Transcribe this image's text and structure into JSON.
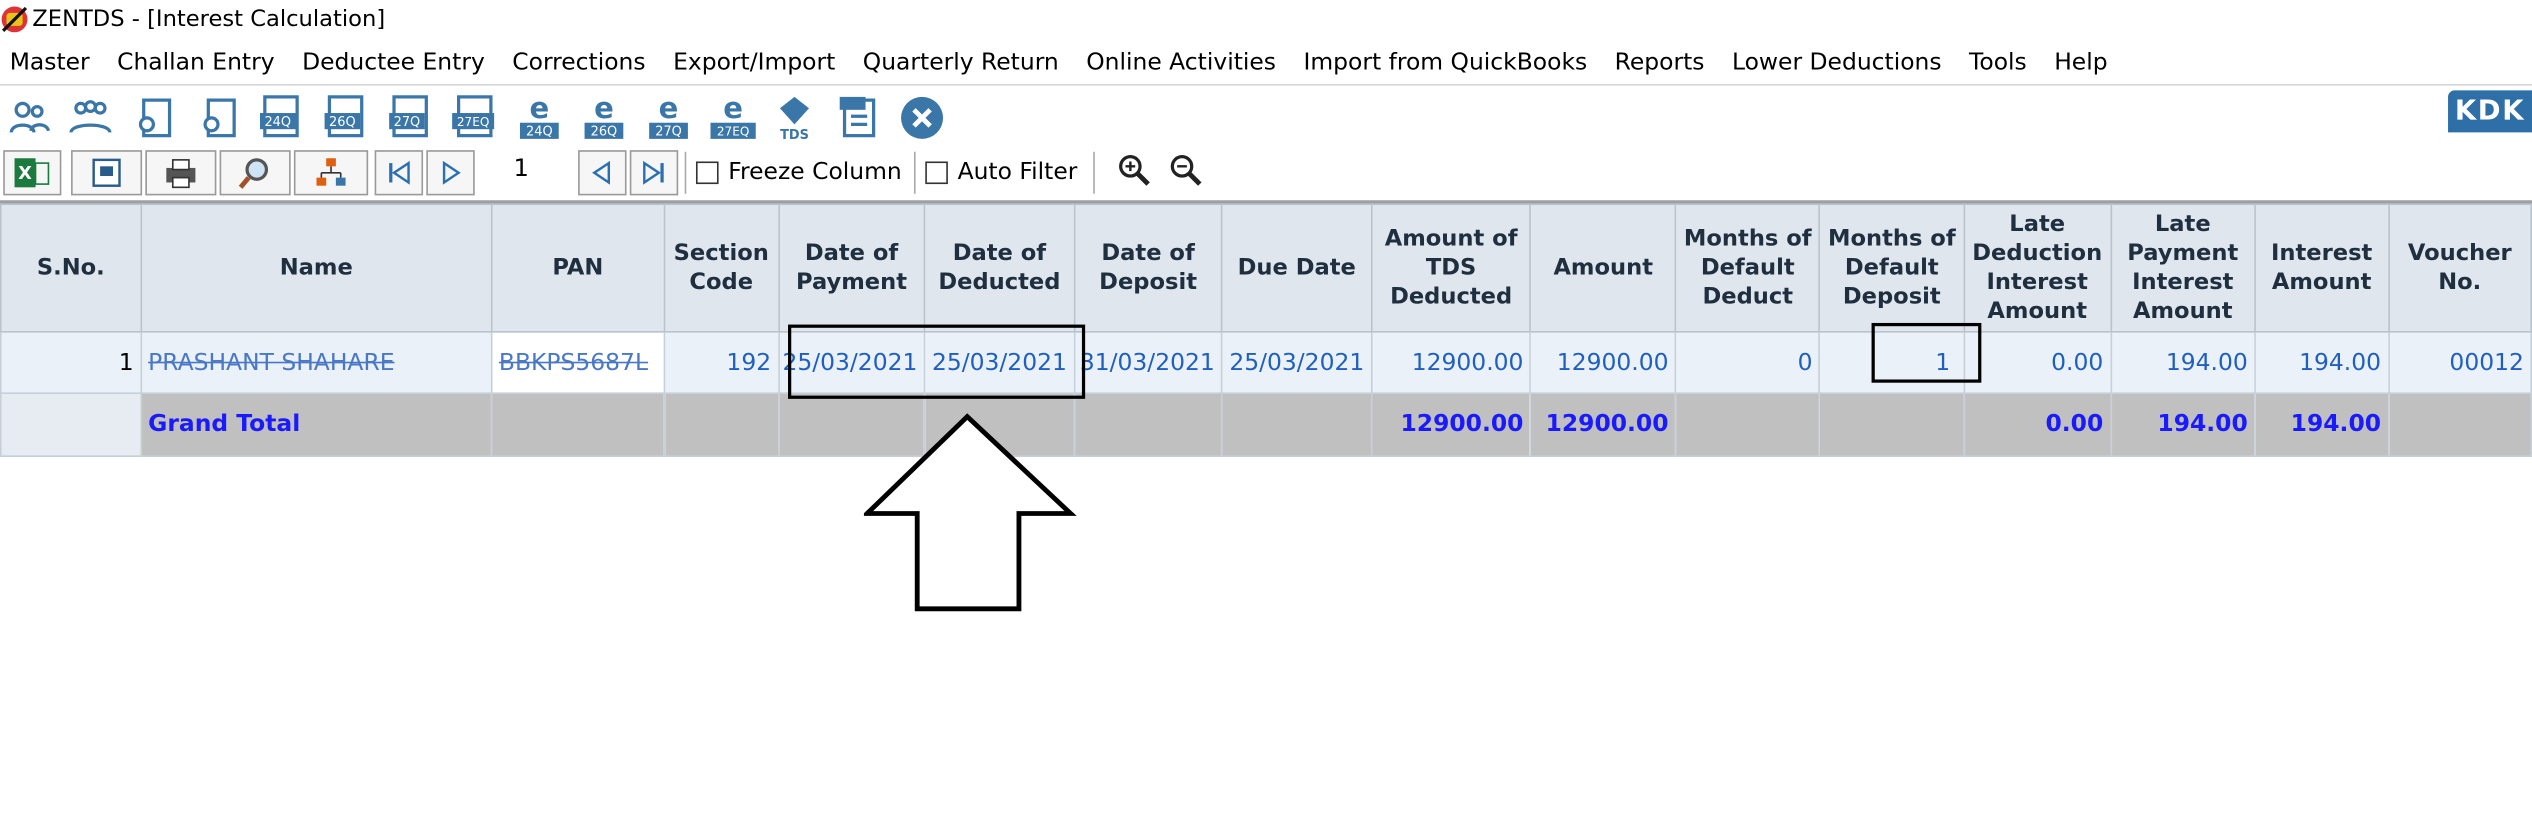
{
  "window": {
    "title": "ZENTDS - [Interest Calculation]"
  },
  "menu": [
    "Master",
    "Challan Entry",
    "Deductee Entry",
    "Corrections",
    "Export/Import",
    "Quarterly Return",
    "Online Activities",
    "Import from QuickBooks",
    "Reports",
    "Lower Deductions",
    "Tools",
    "Help"
  ],
  "toolbar": {
    "icons": [
      "deductor-icon",
      "deductees-icon",
      "form-icon",
      "form2-icon",
      "24q-icon",
      "26q-icon",
      "27q-icon",
      "27eq-icon",
      "e-24q-icon",
      "e-26q-icon",
      "e-27q-icon",
      "e-27eq-icon",
      "tds-icon",
      "pdf-icon",
      "close-icon"
    ],
    "badge_labels": [
      "24Q",
      "26Q",
      "27Q",
      "27EQ",
      "24Q",
      "26Q",
      "27Q",
      "27EQ",
      "TDS"
    ],
    "brand": "KDK"
  },
  "grid_toolbar": {
    "page_number": "1",
    "freeze_column": "Freeze Column",
    "auto_filter": "Auto Filter"
  },
  "table": {
    "columns": [
      "S.No.",
      "Name",
      "PAN",
      "Section Code",
      "Date of Payment",
      "Date of Deducted",
      "Date of Deposit",
      "Due Date",
      "Amount of TDS Deducted",
      "Amount",
      "Months of Default Deduct",
      "Months of Default Deposit",
      "Late Deduction Interest Amount",
      "Late Payment Interest Amount",
      "Interest Amount",
      "Voucher No."
    ],
    "rows": [
      {
        "sno": "1",
        "name": "PRASHANT SHAHARE",
        "pan": "BBKPS5687L",
        "section": "192",
        "date_payment": "25/03/2021",
        "date_deducted": "25/03/2021",
        "date_deposit": "31/03/2021",
        "due_date": "25/03/2021",
        "tds_deducted": "12900.00",
        "amount": "12900.00",
        "months_deduct": "0",
        "months_deposit": "1",
        "late_deduction_interest": "0.00",
        "late_payment_interest": "194.00",
        "interest": "194.00",
        "voucher": "00012"
      }
    ],
    "total": {
      "label": "Grand Total",
      "tds_deducted": "12900.00",
      "amount": "12900.00",
      "late_deduction_interest": "0.00",
      "late_payment_interest": "194.00",
      "interest": "194.00"
    }
  },
  "colors": {
    "header_bg": "#dfe6ee",
    "row_bg": "#eaf1f8",
    "total_bg": "#c0c0c0",
    "value_text": "#1f5fbf",
    "total_text": "#1a1aff",
    "brand": "#2f6fa7"
  }
}
